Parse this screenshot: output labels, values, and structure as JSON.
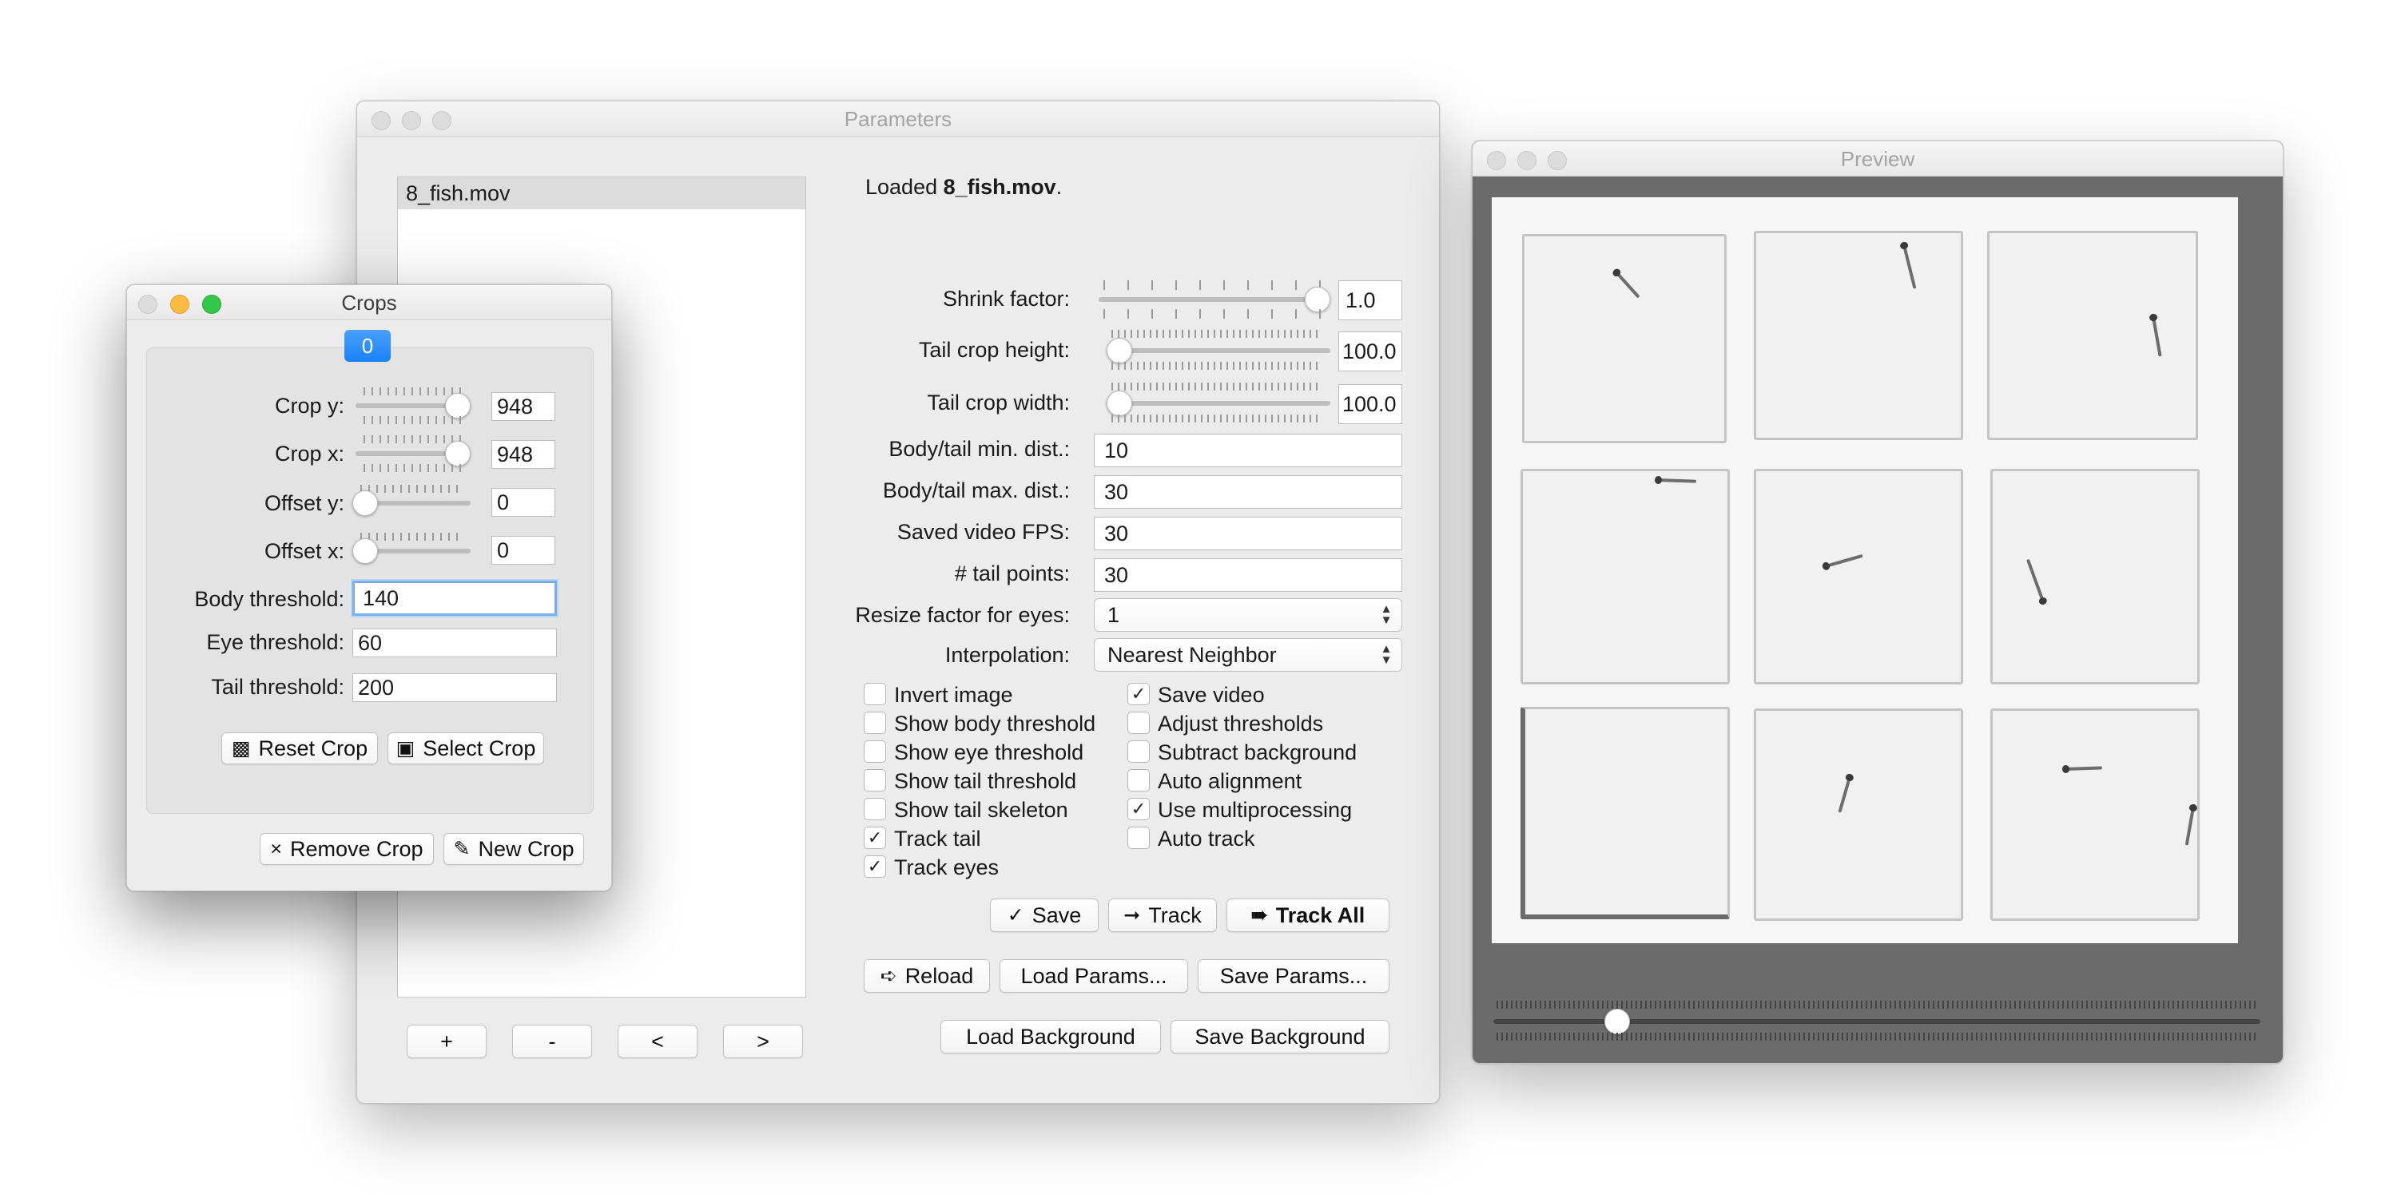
{
  "parameters_window": {
    "title": "Parameters",
    "files": [
      "8_fish.mov"
    ],
    "loaded_prefix": "Loaded ",
    "loaded_file": "8_fish.mov",
    "loaded_suffix": ".",
    "shrink_factor": {
      "label": "Shrink factor:",
      "value": "1.0"
    },
    "tail_crop_height": {
      "label": "Tail crop height:",
      "value": "100.0"
    },
    "tail_crop_width": {
      "label": "Tail crop width:",
      "value": "100.0"
    },
    "body_tail_min_dist": {
      "label": "Body/tail min. dist.:",
      "value": "10"
    },
    "body_tail_max_dist": {
      "label": "Body/tail max. dist.:",
      "value": "30"
    },
    "saved_video_fps": {
      "label": "Saved video FPS:",
      "value": "30"
    },
    "tail_points": {
      "label": "# tail points:",
      "value": "30"
    },
    "resize_factor": {
      "label": "Resize factor for eyes:",
      "value": "1"
    },
    "interpolation": {
      "label": "Interpolation:",
      "value": "Nearest Neighbor"
    },
    "checkboxes_left": [
      {
        "label": "Invert image",
        "checked": false
      },
      {
        "label": "Show body threshold",
        "checked": false
      },
      {
        "label": "Show eye threshold",
        "checked": false
      },
      {
        "label": "Show tail threshold",
        "checked": false
      },
      {
        "label": "Show tail skeleton",
        "checked": false
      },
      {
        "label": "Track tail",
        "checked": true
      },
      {
        "label": "Track eyes",
        "checked": true
      }
    ],
    "checkboxes_right": [
      {
        "label": "Save video",
        "checked": true
      },
      {
        "label": "Adjust thresholds",
        "checked": false
      },
      {
        "label": "Subtract background",
        "checked": false
      },
      {
        "label": "Auto alignment",
        "checked": false
      },
      {
        "label": "Use multiprocessing",
        "checked": true
      },
      {
        "label": "Auto track",
        "checked": false
      }
    ],
    "check_glyph": "✓",
    "buttons": {
      "save": {
        "icon": "✓",
        "label": "Save"
      },
      "track": {
        "icon": "➞",
        "label": "Track"
      },
      "track_all": {
        "icon": "➠",
        "label": "Track All"
      },
      "reload": {
        "icon": "➪",
        "label": "Reload"
      },
      "load_params": "Load Params...",
      "save_params": "Save Params...",
      "load_background": "Load Background",
      "save_background": "Save Background",
      "add": "+",
      "remove": "-",
      "prev": "<",
      "next": ">"
    },
    "slider_levels": {
      "shrink_factor": 1.0,
      "tail_crop_height": 0.04,
      "tail_crop_width": 0.04
    }
  },
  "crops_window": {
    "title": "Crops",
    "tab_label": "0",
    "crop_y": {
      "label": "Crop y:",
      "value": "948",
      "level": 1.0
    },
    "crop_x": {
      "label": "Crop x:",
      "value": "948",
      "level": 1.0
    },
    "offset_y": {
      "label": "Offset y:",
      "value": "0",
      "level": 0.0
    },
    "offset_x": {
      "label": "Offset x:",
      "value": "0",
      "level": 0.0
    },
    "body_threshold": {
      "label": "Body threshold:",
      "value": "140"
    },
    "eye_threshold": {
      "label": "Eye threshold:",
      "value": "60"
    },
    "tail_threshold": {
      "label": "Tail threshold:",
      "value": "200"
    },
    "reset_crop": {
      "icon": "▩",
      "label": "Reset Crop"
    },
    "select_crop": {
      "icon": "▣",
      "label": "Select Crop"
    },
    "remove_crop": {
      "icon": "×",
      "label": "Remove Crop"
    },
    "new_crop": {
      "icon": "✎",
      "label": "New Crop"
    }
  },
  "preview_window": {
    "title": "Preview",
    "frame_slider_level": 0.15
  },
  "colors": {
    "accent": "#1a82fb",
    "window_bg": "#ececec",
    "preview_bg": "#6b6b6b"
  }
}
